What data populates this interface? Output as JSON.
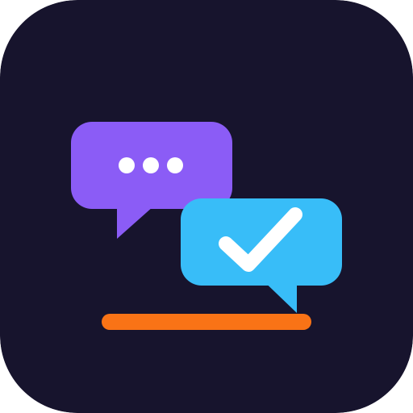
{
  "app_icon": {
    "icon": "chat-bubbles-check-icon",
    "colors": {
      "background": "#17142d",
      "typing_bubble": "#8b5cf6",
      "reply_bubble": "#38bdf8",
      "dots": "#ffffff",
      "checkmark": "#ffffff",
      "underline": "#f97316"
    },
    "typing_bubble": {
      "icon": "typing-dots-icon",
      "dot_count": 3
    },
    "reply_bubble": {
      "icon": "checkmark-icon"
    }
  }
}
